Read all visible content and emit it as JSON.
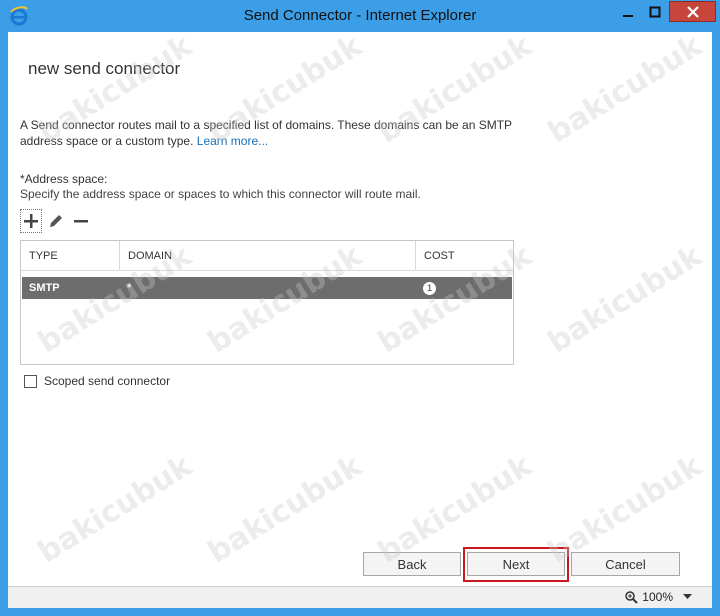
{
  "window": {
    "title": "Send Connector - Internet Explorer",
    "close_glyph": "✕"
  },
  "page": {
    "title": "new send connector",
    "description": "A Send connector routes mail to a specified list of domains. These domains can be an SMTP address space or a custom type. ",
    "learn_more": "Learn more...",
    "address_label": "*Address space:",
    "address_hint": "Specify the address space or spaces to which this connector will route mail."
  },
  "table": {
    "columns": [
      "TYPE",
      "DOMAIN",
      "COST"
    ],
    "rows": [
      {
        "type": "SMTP",
        "domain": "*",
        "cost": "1"
      }
    ]
  },
  "options": {
    "scoped_label": "Scoped send connector",
    "scoped_checked": false
  },
  "buttons": {
    "back": "Back",
    "next": "Next",
    "cancel": "Cancel"
  },
  "statusbar": {
    "zoom": "100%"
  },
  "watermark": "bakicubuk",
  "colors": {
    "title_bar": "#3c9ee6",
    "close_button": "#c7463c",
    "selected_row": "#6d6d6d",
    "link": "#1a6fb5",
    "highlight": "#c8171d"
  }
}
